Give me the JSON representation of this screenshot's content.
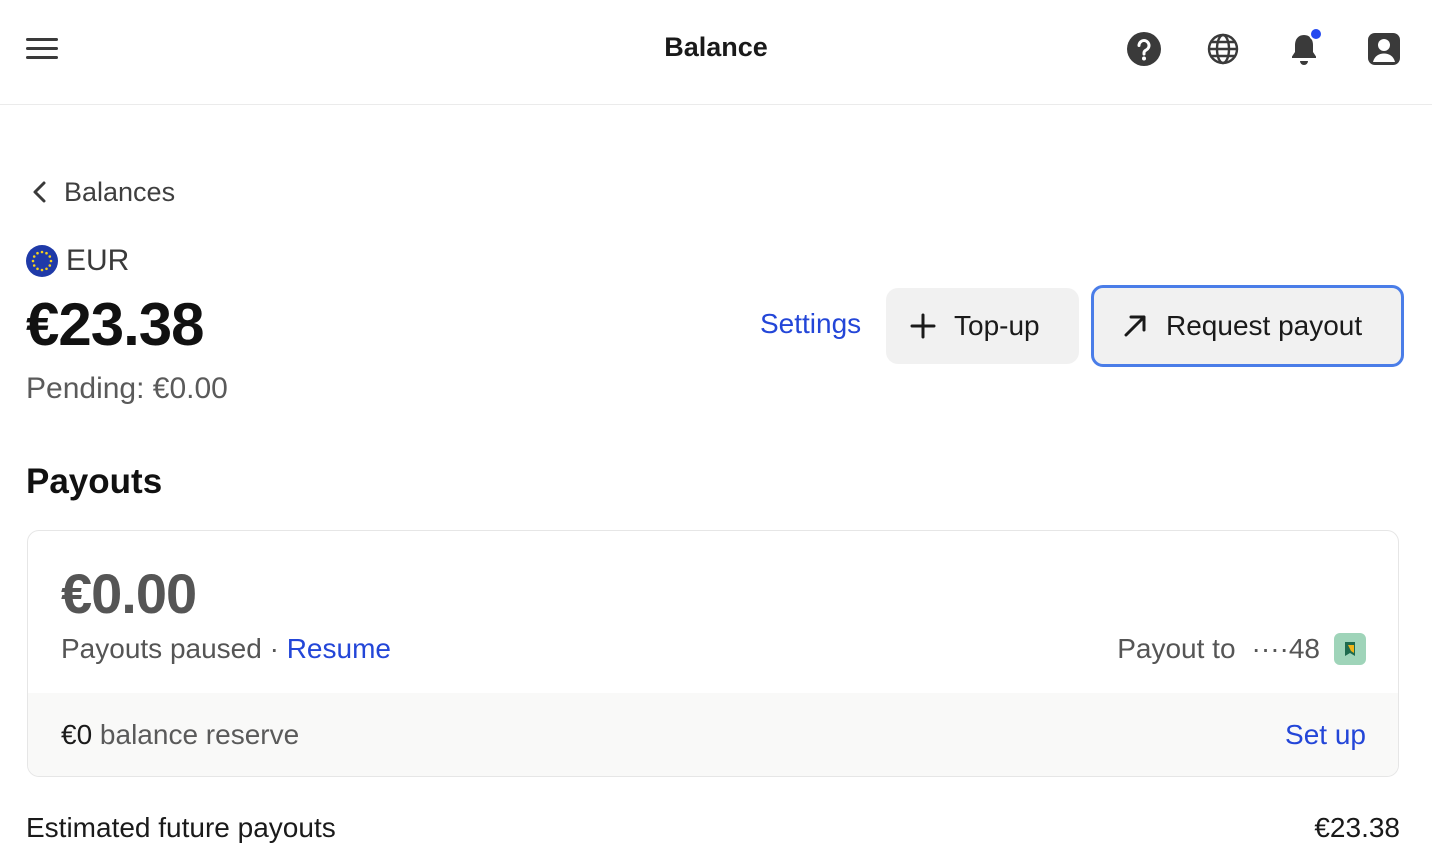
{
  "header": {
    "title": "Balance",
    "icons": [
      "menu-icon",
      "help-icon",
      "globe-icon",
      "bell-icon",
      "account-icon"
    ],
    "notification_dot_color": "#2348f0"
  },
  "breadcrumb": {
    "back_label": "Balances"
  },
  "balance": {
    "currency_code": "EUR",
    "currency_icon": "eu-flag-icon",
    "amount": "€23.38",
    "pending": "Pending: €0.00"
  },
  "actions": {
    "settings_label": "Settings",
    "topup_label": "Top-up",
    "request_payout_label": "Request payout"
  },
  "payouts": {
    "section_title": "Payouts",
    "amount": "€0.00",
    "status_text": "Payouts paused · ",
    "resume_label": "Resume",
    "payout_to_label": "Payout to",
    "account_mask": "····48",
    "reserve_amount": "€0",
    "reserve_label": " balance reserve",
    "setup_label": "Set up"
  },
  "future": {
    "label": "Estimated future payouts",
    "value": "€23.38"
  },
  "colors": {
    "link": "#2346d8",
    "focus_ring": "#4a7de8",
    "button_bg": "#f1f1f1"
  }
}
